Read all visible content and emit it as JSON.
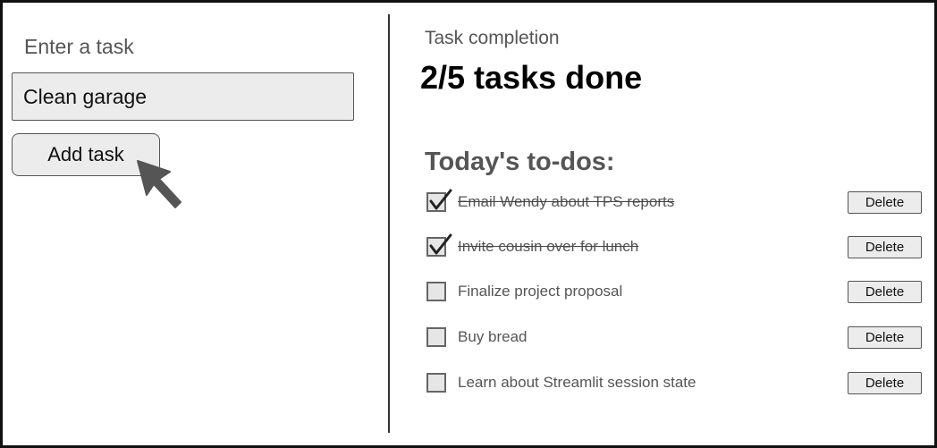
{
  "left_panel": {
    "input_label": "Enter a task",
    "input_value": "Clean garage",
    "add_button_label": "Add task"
  },
  "right_panel": {
    "completion_label": "Task completion",
    "completion_value": "2/5 tasks done",
    "todos_heading": "Today's to-dos:",
    "delete_label": "Delete",
    "todos": [
      {
        "text": "Email Wendy about TPS reports",
        "done": true
      },
      {
        "text": "Invite cousin over for lunch",
        "done": true
      },
      {
        "text": "Finalize project proposal",
        "done": false
      },
      {
        "text": "Buy bread",
        "done": false
      },
      {
        "text": "Learn about Streamlit session state",
        "done": false
      }
    ]
  },
  "icons": {
    "cursor": "mouse-pointer-icon",
    "check": "checkmark-icon"
  },
  "colors": {
    "border": "#111111",
    "control_bg": "#ececec",
    "muted_text": "#555555"
  }
}
